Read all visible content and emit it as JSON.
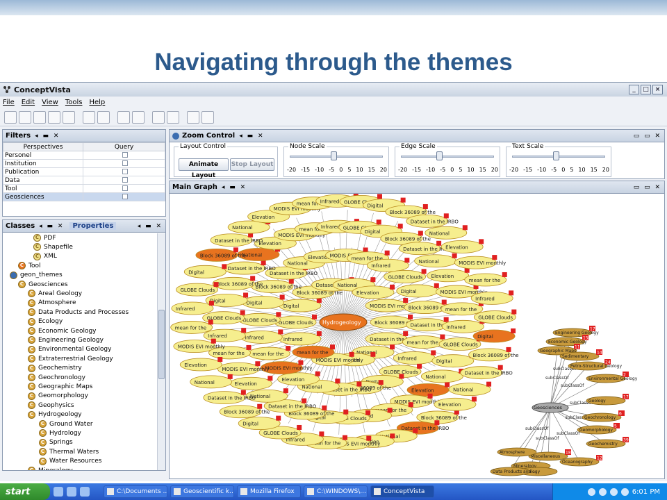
{
  "slide": {
    "title": "Navigating through the themes"
  },
  "app": {
    "title": "ConceptVista",
    "window_buttons": [
      "_",
      "□",
      "×"
    ],
    "menus": [
      "File",
      "Edit",
      "View",
      "Tools",
      "Help"
    ]
  },
  "filters": {
    "title": "Filters",
    "columns": [
      "Perspectives",
      "Query"
    ],
    "rows": [
      "Personel",
      "Institution",
      "Publication",
      "Data",
      "Tool",
      "Geosciences"
    ],
    "selected": "Geosciences"
  },
  "classes": {
    "tabs": [
      "Classes",
      "Properties"
    ],
    "items": [
      {
        "label": "PDF",
        "icon": "class-icon"
      },
      {
        "label": "Shapefile",
        "icon": "class-icon"
      },
      {
        "label": "XML",
        "icon": "class-icon"
      },
      {
        "label": "Tool",
        "icon": "class-icon-orange"
      },
      {
        "label": "geon_themes",
        "icon": "globe-icon"
      },
      {
        "label": "Geosciences",
        "icon": "class-icon"
      },
      {
        "label": "Areal Geology",
        "icon": "class-icon"
      },
      {
        "label": "Atmosphere",
        "icon": "class-icon"
      },
      {
        "label": "Data Products and Processes",
        "icon": "class-icon"
      },
      {
        "label": "Ecology",
        "icon": "class-icon"
      },
      {
        "label": "Economic Geology",
        "icon": "class-icon"
      },
      {
        "label": "Engineering Geology",
        "icon": "class-icon"
      },
      {
        "label": "Environmental Geology",
        "icon": "class-icon"
      },
      {
        "label": "Extraterrestrial Geology",
        "icon": "class-icon"
      },
      {
        "label": "Geochemistry",
        "icon": "class-icon"
      },
      {
        "label": "Geochronology",
        "icon": "class-icon"
      },
      {
        "label": "Geographic Maps",
        "icon": "class-icon"
      },
      {
        "label": "Geomorphology",
        "icon": "class-icon"
      },
      {
        "label": "Geophysics",
        "icon": "class-icon"
      },
      {
        "label": "Hydrogeology",
        "icon": "class-icon"
      },
      {
        "label": "Ground Water",
        "icon": "class-icon"
      },
      {
        "label": "Hydrology",
        "icon": "class-icon"
      },
      {
        "label": "Springs",
        "icon": "class-icon"
      },
      {
        "label": "Thermal Waters",
        "icon": "class-icon"
      },
      {
        "label": "Water Resources",
        "icon": "class-icon"
      },
      {
        "label": "Mineralogy",
        "icon": "class-icon"
      }
    ]
  },
  "zoom": {
    "title": "Zoom Control",
    "layout_control": "Layout Control",
    "animate_label": "Animate Layout",
    "stop_label": "Stop Layout",
    "scales": [
      {
        "label": "Node Scale",
        "value": 0
      },
      {
        "label": "Edge Scale",
        "value": 0
      },
      {
        "label": "Text Scale",
        "value": 0
      }
    ],
    "ticks": [
      "-20",
      "-15",
      "-10",
      "-5",
      "0",
      "5",
      "10",
      "15",
      "20"
    ]
  },
  "graph": {
    "title": "Main Graph",
    "center_label": "Hydrogeology",
    "labels": [
      "Block 36089 of the",
      "Dataset in the IRBO",
      "National",
      "Elevation",
      "MODIS EVI monthly",
      "mean for the",
      "Infrared",
      "GLOBE Clouds",
      "Digital"
    ],
    "cluster_center": "Geosciences",
    "cluster_edge_label": "subClassOf",
    "cluster_nodes": [
      "Engineering Geology",
      "Economic Geology",
      "Geographic Maps",
      "Sedimentary",
      "Petro-Structural Geology",
      "Environmental Geology",
      "Geology",
      "Geochronology",
      "Geomorphology",
      "Geochemistry",
      "Oceanography",
      "Miscellaneous",
      "Atmosphere",
      "Mineralogy",
      "Petrology",
      "Data Products and..."
    ],
    "cluster_badges": [
      "17",
      "15",
      "11",
      "14",
      "24",
      "2",
      "17",
      "6",
      "5",
      "39",
      "12",
      "18"
    ]
  },
  "taskbar": {
    "start": "start",
    "tasks": [
      "C:\\Documents ...",
      "Geoscientific k...",
      "Mozilla Firefox",
      "C:\\WINDOWS\\...",
      "ConceptVista"
    ],
    "active": "ConceptVista",
    "time": "6:01 PM"
  }
}
